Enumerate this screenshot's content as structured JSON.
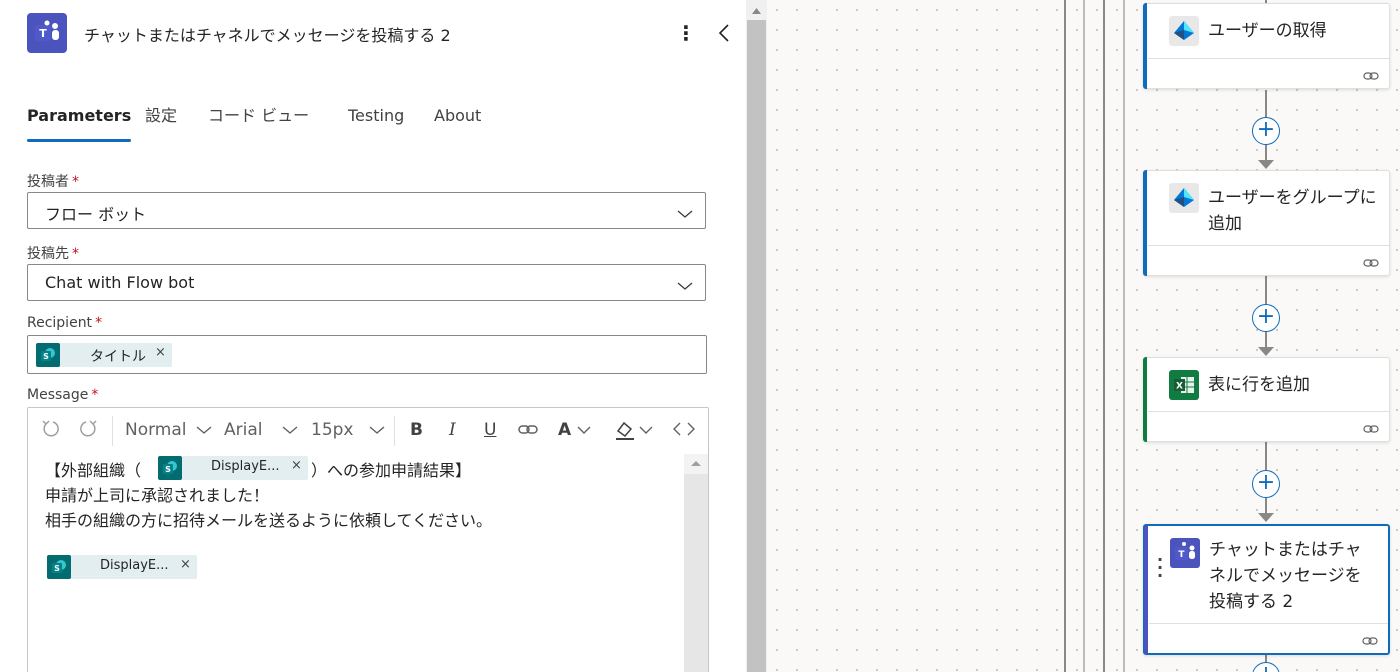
{
  "panel": {
    "title": "チャットまたはチャネルでメッセージを投稿する 2",
    "more_icon": "more-vertical-icon",
    "collapse_icon": "chevron-left-icon",
    "tabs": [
      {
        "label": "Parameters",
        "active": true
      },
      {
        "label": "設定",
        "active": false
      },
      {
        "label": "コード ビュー",
        "active": false
      },
      {
        "label": "Testing",
        "active": false
      },
      {
        "label": "About",
        "active": false
      }
    ],
    "fields": {
      "post_as": {
        "label": "投稿者",
        "required": "*",
        "value": "フロー ボット"
      },
      "post_in": {
        "label": "投稿先",
        "required": "*",
        "value": "Chat with Flow bot"
      },
      "recipient": {
        "label": "Recipient",
        "required": "*",
        "token": {
          "label": "タイトル",
          "remove": "×"
        }
      },
      "message": {
        "label": "Message",
        "required": "*"
      }
    },
    "editor": {
      "toolbar": {
        "undo_icon": "undo-icon",
        "redo_icon": "redo-icon",
        "paragraph_style": "Normal",
        "font": "Arial",
        "font_size": "15px",
        "bold": "B",
        "italic": "I",
        "underline": "U",
        "link_icon": "link-icon",
        "font_color": "A",
        "highlight_icon": "highlight-icon",
        "code_view": "<>"
      },
      "lines": {
        "line1_before": "【外部組織（",
        "line1_token": "DisplayE...",
        "line1_after": "）への参加申請結果】",
        "line2": "申請が上司に承認されました！",
        "line3": "相手の組織の方に招待メールを送るように依頼してください。",
        "line5_token": "DisplayE..."
      },
      "token_remove": "×"
    }
  },
  "canvas": {
    "accent_colors": {
      "entra": "#0f6cbd",
      "excel": "#107c41",
      "teams": "#4b53bc"
    },
    "cards": [
      {
        "title": "ユーザーの取得",
        "icon": "entra-id-icon"
      },
      {
        "title": "ユーザーをグループに追加",
        "icon": "entra-id-icon"
      },
      {
        "title": "表に行を追加",
        "icon": "excel-icon"
      },
      {
        "title": "チャットまたはチャネルでメッセージを投稿する 2",
        "icon": "teams-icon",
        "selected": true
      }
    ],
    "add_step_label": "+"
  }
}
